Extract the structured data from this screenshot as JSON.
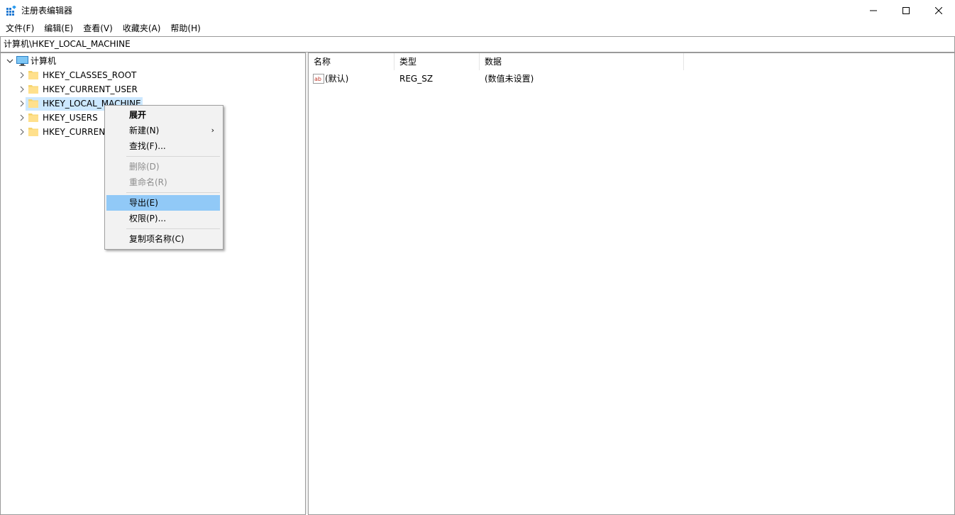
{
  "window": {
    "title": "注册表编辑器",
    "controls": {
      "minimize": "—",
      "maximize": "☐",
      "close": "✕"
    }
  },
  "menubar": {
    "items": [
      "文件(F)",
      "编辑(E)",
      "查看(V)",
      "收藏夹(A)",
      "帮助(H)"
    ]
  },
  "address": {
    "path": "计算机\\HKEY_LOCAL_MACHINE"
  },
  "tree": {
    "root": {
      "label": "计算机",
      "icon": "computer-icon",
      "expanded": true
    },
    "children": [
      {
        "label": "HKEY_CLASSES_ROOT",
        "icon": "folder-icon"
      },
      {
        "label": "HKEY_CURRENT_USER",
        "icon": "folder-icon"
      },
      {
        "label": "HKEY_LOCAL_MACHINE",
        "icon": "folder-icon",
        "selected": true
      },
      {
        "label": "HKEY_USERS",
        "icon": "folder-icon"
      },
      {
        "label": "HKEY_CURRENT",
        "icon": "folder-icon"
      }
    ],
    "selected_color": "#cce8ff"
  },
  "list": {
    "columns": [
      "名称",
      "类型",
      "数据"
    ],
    "rows": [
      {
        "name": "(默认)",
        "type": "REG_SZ",
        "data": "(数值未设置)",
        "icon": "string-value-icon"
      }
    ]
  },
  "context_menu": {
    "items": [
      {
        "label": "展开",
        "bold": true
      },
      {
        "label": "新建(N)",
        "submenu": true
      },
      {
        "label": "查找(F)..."
      },
      {
        "label": "删除(D)",
        "disabled": true
      },
      {
        "label": "重命名(R)",
        "disabled": true
      },
      {
        "label": "导出(E)",
        "highlighted": true
      },
      {
        "label": "权限(P)..."
      },
      {
        "label": "复制项名称(C)"
      }
    ],
    "submenu_arrow": "›",
    "highlight_color": "#91c9f7"
  }
}
